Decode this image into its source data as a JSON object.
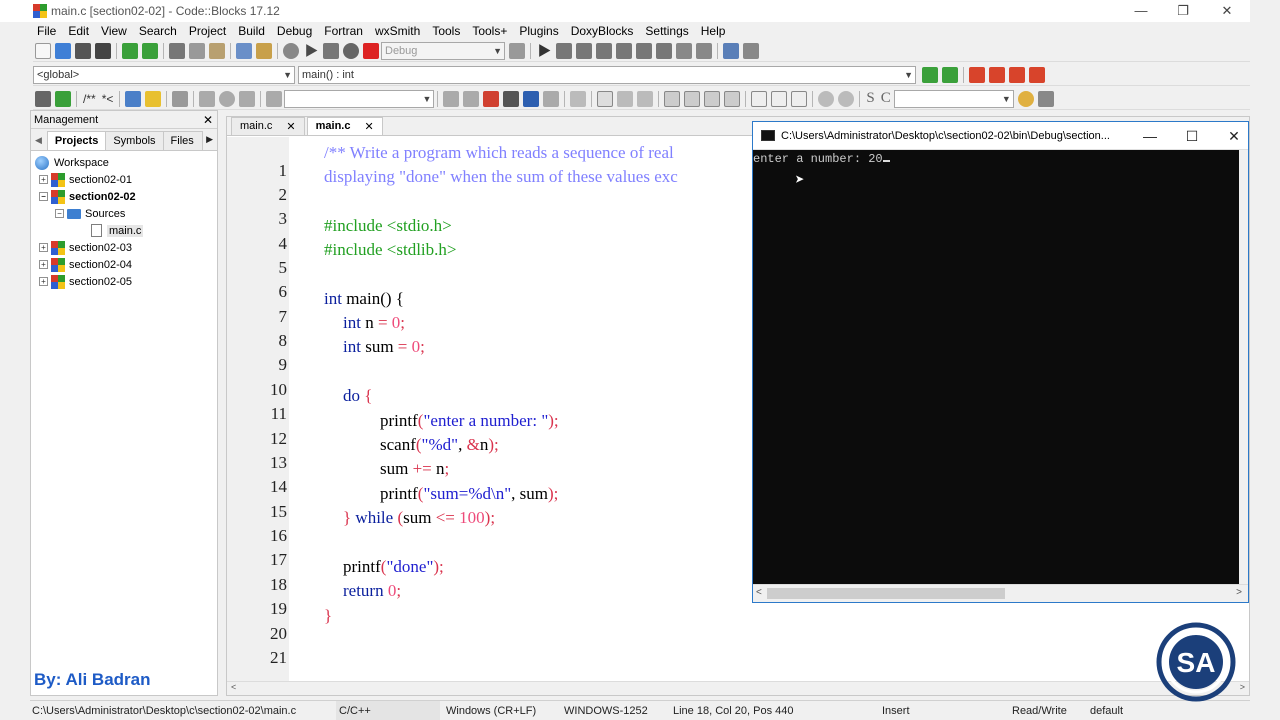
{
  "window": {
    "title": "main.c [section02-02] - Code::Blocks 17.12",
    "minimize": "—",
    "maximize": "❐",
    "close": "✕"
  },
  "menu": [
    "File",
    "Edit",
    "View",
    "Search",
    "Project",
    "Build",
    "Debug",
    "Fortran",
    "wxSmith",
    "Tools",
    "Tools+",
    "Plugins",
    "DoxyBlocks",
    "Settings",
    "Help"
  ],
  "toolbar": {
    "build_target": "Debug",
    "scope": "<global>",
    "function": "main() : int",
    "doxy_comment": "/**",
    "doxy_inline": "*<",
    "search_s": "S",
    "search_c": "C"
  },
  "management": {
    "title": "Management",
    "close": "✕",
    "tabs": [
      "Projects",
      "Symbols",
      "Files"
    ],
    "tree": {
      "workspace": "Workspace",
      "projects": [
        "section02-01",
        "section02-02",
        "section02-03",
        "section02-04",
        "section02-05"
      ],
      "sources_folder": "Sources",
      "file": "main.c"
    },
    "author": "By: Ali Badran"
  },
  "editor": {
    "tabs": [
      {
        "label": "main.c",
        "close": "✕"
      },
      {
        "label": "main.c",
        "close": "✕"
      }
    ],
    "line_numbers": [
      "1",
      "2",
      "3",
      "4",
      "5",
      "6",
      "7",
      "8",
      "9",
      "10",
      "11",
      "12",
      "13",
      "14",
      "15",
      "16",
      "17",
      "18",
      "19",
      "20",
      "21"
    ],
    "code": {
      "l1": "/** Write a program which reads a sequence of real",
      "l2": "displaying \"done\" when the sum of these values exc",
      "l4": "#include <stdio.h>",
      "l5": "#include <stdlib.h>",
      "l7_kw": "int",
      "l7_rest": " main() {",
      "l8_kw": "int",
      "l8_id": " n ",
      "l8_op": "=",
      "l8_num": " 0",
      "l8_end": ";",
      "l9_kw": "int",
      "l9_id": " sum ",
      "l9_op": "=",
      "l9_num": " 0",
      "l9_end": ";",
      "l11_kw": "do",
      "l11_brace": " {",
      "l12_fn": "printf",
      "l12_p1": "(",
      "l12_str": "\"enter a number: \"",
      "l12_p2": ");",
      "l13_fn": "scanf",
      "l13_p1": "(",
      "l13_str": "\"%d\"",
      "l13_mid": ", ",
      "l13_amp": "&",
      "l13_id": "n",
      "l13_p2": ");",
      "l14_id": "sum ",
      "l14_op": "+=",
      "l14_id2": " n",
      "l14_end": ";",
      "l15_fn": "printf",
      "l15_p1": "(",
      "l15_str": "\"sum=%d\\n\"",
      "l15_mid": ", sum",
      "l15_p2": ");",
      "l16_brace": "} ",
      "l16_kw": "while",
      "l16_p1": " (",
      "l16_id": "sum ",
      "l16_op": "<=",
      "l16_num": " 100",
      "l16_p2": ");",
      "l18_fn": "printf",
      "l18_p1": "(",
      "l18_str": "\"done\"",
      "l18_p2": ");",
      "l19_kw": "return",
      "l19_num": " 0",
      "l19_end": ";",
      "l20": "}"
    }
  },
  "console": {
    "title": "C:\\Users\\Administrator\\Desktop\\c\\section02-02\\bin\\Debug\\section...",
    "prompt": "enter a number: 20",
    "minimize": "—",
    "maximize": "☐",
    "close": "✕"
  },
  "statusbar": {
    "path": "C:\\Users\\Administrator\\Desktop\\c\\section02-02\\main.c",
    "language": "C/C++",
    "eol": "Windows (CR+LF)",
    "encoding": "WINDOWS-1252",
    "position": "Line 18, Col 20, Pos 440",
    "mode": "Insert",
    "access": "Read/Write",
    "theme": "default"
  },
  "logo_text": "SA",
  "colors": {
    "comment": "#8080ff",
    "preprocessor": "#22a022",
    "keyword": "#0a1f9d",
    "number": "#ee4a7a",
    "string": "#2020d0",
    "author": "#1e5bc6",
    "console_bg": "#0c0c0c"
  }
}
